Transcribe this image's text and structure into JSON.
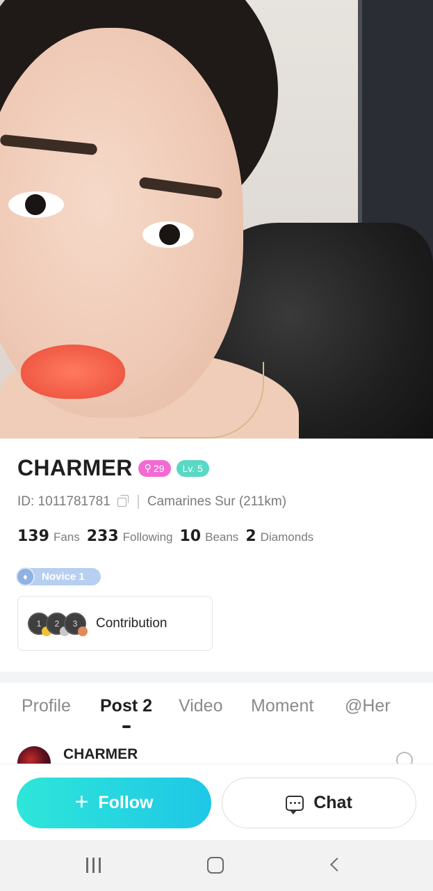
{
  "profile": {
    "name": "CHARMER",
    "badge_search": "29",
    "badge_level": "Lv. 5",
    "id_text": "ID: 1011781781",
    "location": "Camarines Sur (211km)",
    "stats": [
      {
        "value": "139",
        "label": "Fans"
      },
      {
        "value": "233",
        "label": "Following"
      },
      {
        "value": "10",
        "label": "Beans"
      },
      {
        "value": "2",
        "label": "Diamonds"
      }
    ],
    "rank_label": "Novice 1",
    "contribution_label": "Contribution",
    "medals": [
      "1",
      "2",
      "3"
    ]
  },
  "tabs": [
    {
      "label": "Profile",
      "active": false
    },
    {
      "label": "Post 2",
      "active": true
    },
    {
      "label": "Video",
      "active": false
    },
    {
      "label": "Moment",
      "active": false
    },
    {
      "label": "@Her",
      "active": false
    }
  ],
  "post_preview": {
    "author": "CHARMER"
  },
  "actions": {
    "follow_label": "Follow",
    "chat_label": "Chat"
  },
  "colors": {
    "follow_gradient_start": "#2ee6d9",
    "follow_gradient_end": "#1ec7e6",
    "badge_pink": "#f36ad3",
    "badge_teal": "#58d8c5"
  }
}
